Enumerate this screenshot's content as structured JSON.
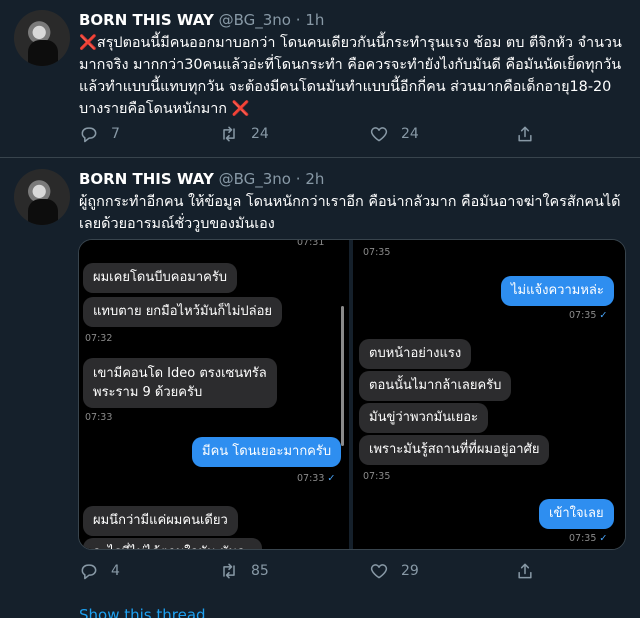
{
  "tweets": [
    {
      "display_name": "BORN THIS WAY",
      "handle": "@BG_3no",
      "separator": "·",
      "time": "1h",
      "lead_mark": "❌",
      "text": "สรุปตอนนี้มีคนออกมาบอกว่า โดนคนเดียวกันนี้กระทำรุนแรง ช้อม ตบ ตีจิกหัว จำนวนมากจริง มากกว่า30คนแล้วอ่ะที่โดนกระทำ คือควรจะทำยังไงกับมันดี คือมันนัดเย็ดทุกวัน แล้วทำแบบนี้แทบทุกวัน จะต้องมีคนโดนมันทำแบบนี้อีกกี่คน ส่วนมากคือเด็กอายุ18-20 บางรายคือโดนหนักมาก",
      "trail_mark": "❌",
      "replies": "7",
      "retweets": "24",
      "likes": "24"
    },
    {
      "display_name": "BORN THIS WAY",
      "handle": "@BG_3no",
      "separator": "·",
      "time": "2h",
      "text": "ผู้ถูกกระทำอีกคน ให้ข้อมูล โดนหนักกว่าเราอีก คือน่ากลัวมาก คือมันอาจฆ่าใครสักคนได้เลยด้วยอารมณ์ชั่ววูบของมันเอง",
      "replies": "4",
      "retweets": "85",
      "likes": "29"
    }
  ],
  "chat_left": {
    "top_time": "07:31",
    "msg1": "ผมเคยโดนบีบคอมาครับ",
    "msg2": "แทบตาย ยกมือไหว้มันก็ไม่ปล่อย",
    "time2": "07:32",
    "msg3_line1": "เขามีคอนโด Ideo ตรงเซนทรัล",
    "msg3_line2": "พระราม 9 ด้วยครับ",
    "time3": "07:33",
    "msg4": "มีคน โดนเยอะมากครับ",
    "time4": "07:33",
    "msg5": "ผมนึกว่ามีแค่ผมคนเดียว",
    "msg6": "อะไรที่ไม่ได้ตามใจมัน มันจะ"
  },
  "chat_right": {
    "top_time": "07:35",
    "msg1": "ไม่แจ้งความหล่ะ",
    "time1": "07:35",
    "msg2": "ตบหน้าอย่างแรง",
    "msg3": "ตอนนั้นไมากล้าเลยครับ",
    "msg4": "มันขู่ว่าพวกมันเยอะ",
    "msg5": "เพราะมันรู้สถานที่ที่ผมอยู่อาศัย",
    "time5": "07:35",
    "msg6": "เข้าใจเลย",
    "time6": "07:35"
  },
  "read_check": "✓",
  "show_thread": "Show this thread",
  "colors": {
    "background": "#15202b",
    "link": "#1da1f2",
    "muted": "#8899a6",
    "x_mark": "#e0245e",
    "bubble_out": "#2e8ef0",
    "bubble_in": "#2c2c2e"
  },
  "icons": [
    "reply-icon",
    "retweet-icon",
    "like-icon",
    "share-icon"
  ]
}
